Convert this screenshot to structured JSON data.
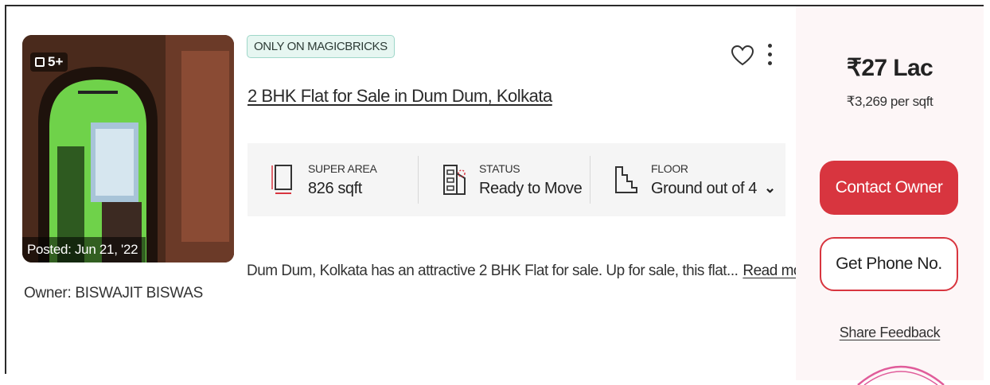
{
  "listing": {
    "photo_count": "5+",
    "posted": "Posted: Jun 21, '22",
    "owner": "Owner: BISWAJIT BISWAS",
    "badge": "ONLY ON MAGICBRICKS",
    "title": "2 BHK Flat for Sale in Dum Dum, Kolkata",
    "facts": [
      {
        "label": "SUPER AREA",
        "value": "826 sqft",
        "icon": "area-icon"
      },
      {
        "label": "STATUS",
        "value": "Ready to Move",
        "icon": "building-status-icon"
      },
      {
        "label": "FLOOR",
        "value": "Ground out of 4",
        "icon": "stairs-floor-icon"
      }
    ],
    "description": "Dum Dum, Kolkata has an attractive 2 BHK Flat for sale. Up for sale, this flat...",
    "read_more": "Read more"
  },
  "pricing": {
    "price": "₹27 Lac",
    "per_sqft": "₹3,269 per sqft",
    "contact_button": "Contact Owner",
    "phone_button": "Get Phone No.",
    "feedback_link": "Share Feedback"
  },
  "colors": {
    "accent": "#d8353f",
    "badge_bg": "#e6f6f1",
    "right_panel_bg": "#fdf6f7"
  }
}
